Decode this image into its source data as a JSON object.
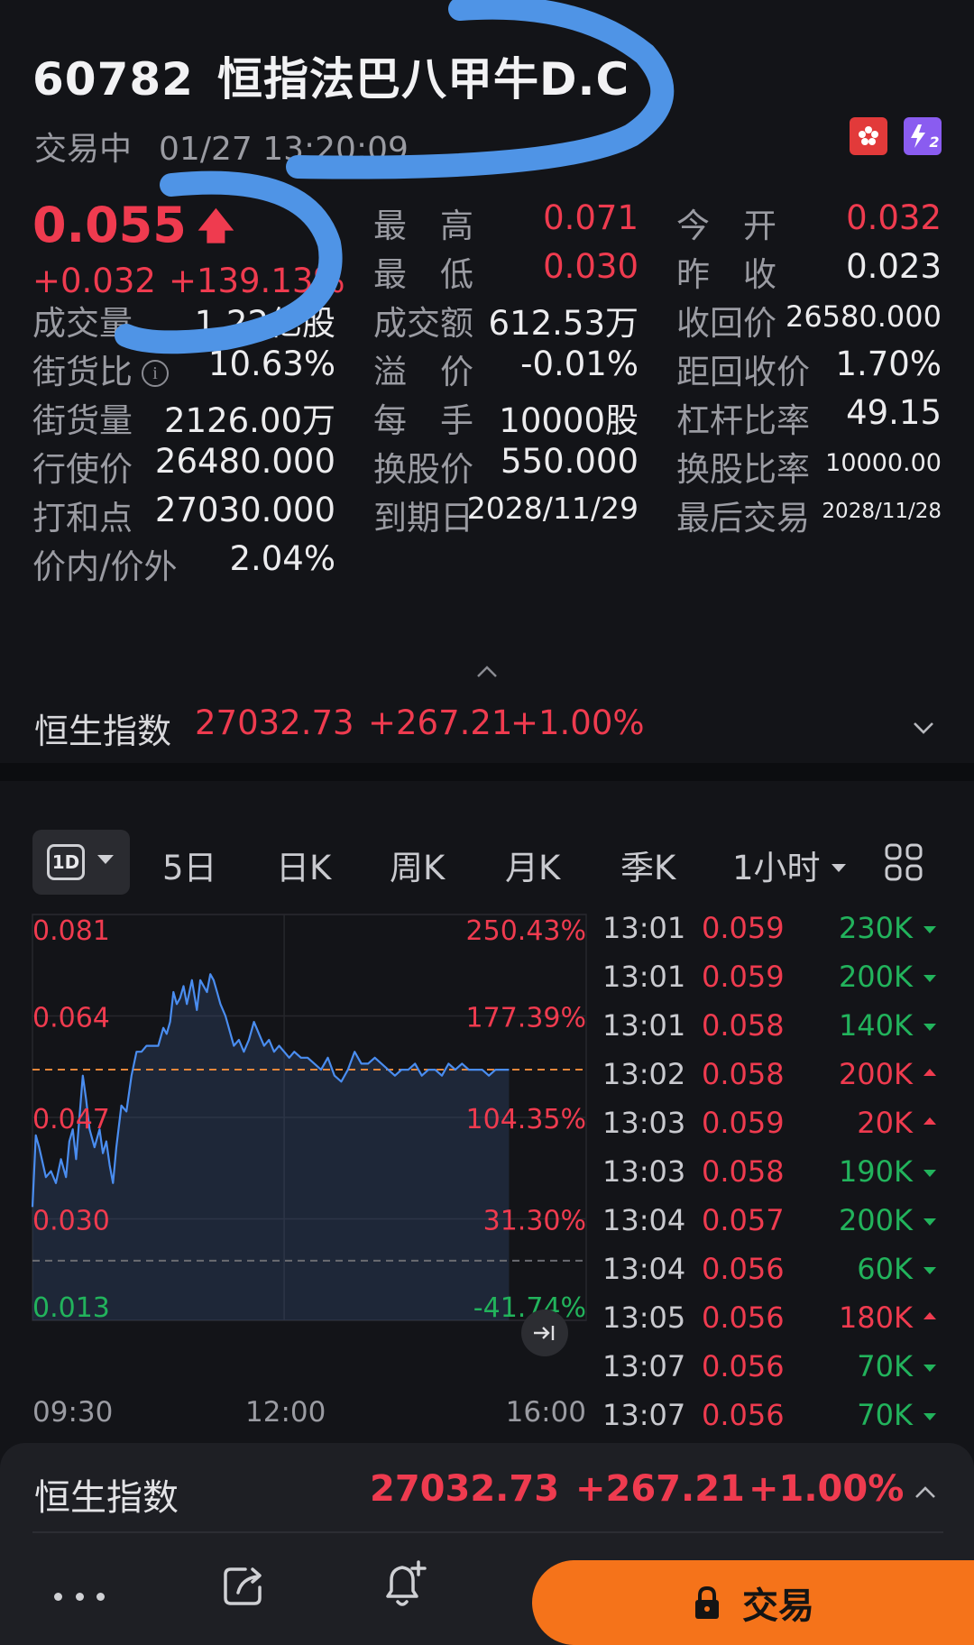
{
  "header": {
    "code": "60782",
    "name": "恒指法巴八甲牛D.C",
    "status": "交易中",
    "datetime": "01/27 13:20:09",
    "hk_flag_icon": "hong-kong-flag-icon",
    "lv2_badge_text": "2"
  },
  "quote": {
    "last_price": "0.055",
    "change": "+0.032",
    "change_pct": "+139.13%",
    "fields": {
      "volume": {
        "label": "成交量",
        "value": "1.22亿股"
      },
      "street_ratio": {
        "label": "街货比",
        "value": "10.63%"
      },
      "street_volume": {
        "label": "街货量",
        "value": "2126.00万"
      },
      "strike": {
        "label": "行使价",
        "value": "26480.000"
      },
      "breakeven": {
        "label": "打和点",
        "value": "27030.000"
      },
      "moneyness": {
        "label": "价内/价外",
        "value": "2.04%"
      },
      "high": {
        "label": "最　高",
        "value": "0.071"
      },
      "low": {
        "label": "最　低",
        "value": "0.030"
      },
      "turnover": {
        "label": "成交额",
        "value": "612.53万"
      },
      "premium": {
        "label": "溢　价",
        "value": "-0.01%"
      },
      "lot_size": {
        "label": "每　手",
        "value": "10000股"
      },
      "conversion_price": {
        "label": "换股价",
        "value": "550.000"
      },
      "expiry": {
        "label": "到期日",
        "value": "2028/11/29"
      },
      "open": {
        "label": "今　开",
        "value": "0.032"
      },
      "prev_close": {
        "label": "昨　收",
        "value": "0.023"
      },
      "call_price": {
        "label": "收回价",
        "value": "26580.000"
      },
      "call_distance": {
        "label": "距回收价",
        "value": "1.70%"
      },
      "leverage": {
        "label": "杠杆比率",
        "value": "49.15"
      },
      "conversion_ratio": {
        "label": "换股比率",
        "value": "10000.00"
      },
      "last_trade": {
        "label": "最后交易",
        "value": "2028/11/28"
      }
    }
  },
  "index_bar": {
    "label": "恒生指数",
    "value": "27032.73",
    "change": "+267.21",
    "change_pct": "+1.00%"
  },
  "tabs": {
    "intraday": "1D",
    "five_day": "5日",
    "daily": "日K",
    "weekly": "周K",
    "monthly": "月K",
    "quarterly": "季K",
    "hourly": "1小时"
  },
  "chart_data": {
    "type": "line",
    "title": "",
    "y_labels_left": [
      "0.081",
      "0.064",
      "0.047",
      "0.030",
      "0.013"
    ],
    "y_labels_right": [
      "250.43%",
      "177.39%",
      "104.35%",
      "31.30%",
      "-41.74%"
    ],
    "ylim": [
      0.013,
      0.081
    ],
    "x_labels": [
      "09:30",
      "12:00",
      "16:00"
    ],
    "x_range_minutes": [
      0,
      330
    ],
    "prev_close": 0.023,
    "reference_price": 0.055,
    "series": [
      {
        "x": [
          0,
          2,
          4,
          8,
          11,
          14,
          17,
          20,
          22,
          24,
          26,
          30,
          32,
          34,
          37,
          40,
          42,
          44,
          46,
          48,
          50,
          53,
          56,
          59,
          62,
          65,
          68,
          72,
          75,
          78,
          80,
          82,
          84,
          86,
          88,
          90,
          92,
          95,
          98,
          100,
          102,
          104,
          106,
          108,
          110,
          112,
          115,
          118,
          120,
          123,
          126,
          129,
          132,
          135,
          138,
          141,
          144,
          147,
          150,
          153,
          156,
          160,
          164,
          168,
          172,
          176,
          180,
          184,
          188,
          192,
          196,
          200,
          204,
          208,
          212,
          216,
          220,
          224,
          228,
          232,
          236,
          240,
          244,
          248,
          252,
          256,
          260,
          264,
          268,
          272,
          276,
          280,
          284
        ],
        "y": [
          0.032,
          0.044,
          0.042,
          0.037,
          0.038,
          0.036,
          0.04,
          0.037,
          0.043,
          0.045,
          0.04,
          0.054,
          0.05,
          0.045,
          0.042,
          0.045,
          0.041,
          0.043,
          0.039,
          0.036,
          0.042,
          0.049,
          0.048,
          0.054,
          0.058,
          0.058,
          0.059,
          0.059,
          0.059,
          0.062,
          0.061,
          0.063,
          0.068,
          0.066,
          0.067,
          0.069,
          0.066,
          0.07,
          0.065,
          0.07,
          0.069,
          0.068,
          0.071,
          0.07,
          0.068,
          0.066,
          0.064,
          0.061,
          0.059,
          0.06,
          0.058,
          0.06,
          0.063,
          0.061,
          0.059,
          0.06,
          0.058,
          0.059,
          0.058,
          0.057,
          0.058,
          0.057,
          0.057,
          0.056,
          0.055,
          0.057,
          0.054,
          0.053,
          0.055,
          0.058,
          0.056,
          0.056,
          0.057,
          0.056,
          0.055,
          0.054,
          0.055,
          0.055,
          0.056,
          0.054,
          0.055,
          0.055,
          0.054,
          0.056,
          0.055,
          0.056,
          0.055,
          0.055,
          0.055,
          0.054,
          0.055,
          0.055,
          0.055
        ]
      }
    ]
  },
  "ticks": [
    {
      "time": "13:01",
      "price": "0.059",
      "volume": "230K",
      "dir": "down"
    },
    {
      "time": "13:01",
      "price": "0.059",
      "volume": "200K",
      "dir": "down"
    },
    {
      "time": "13:01",
      "price": "0.058",
      "volume": "140K",
      "dir": "down"
    },
    {
      "time": "13:02",
      "price": "0.058",
      "volume": "200K",
      "dir": "up"
    },
    {
      "time": "13:03",
      "price": "0.059",
      "volume": "20K",
      "dir": "up"
    },
    {
      "time": "13:03",
      "price": "0.058",
      "volume": "190K",
      "dir": "down"
    },
    {
      "time": "13:04",
      "price": "0.057",
      "volume": "200K",
      "dir": "down"
    },
    {
      "time": "13:04",
      "price": "0.056",
      "volume": "60K",
      "dir": "down"
    },
    {
      "time": "13:05",
      "price": "0.056",
      "volume": "180K",
      "dir": "up"
    },
    {
      "time": "13:07",
      "price": "0.056",
      "volume": "70K",
      "dir": "down"
    },
    {
      "time": "13:07",
      "price": "0.056",
      "volume": "70K",
      "dir": "down"
    }
  ],
  "bottom": {
    "index_label": "恒生指数",
    "index_value": "27032.73",
    "index_change": "+267.21",
    "index_pct": "+1.00%",
    "trade_label": "交易"
  },
  "colors": {
    "up": "#ef3b4f",
    "down": "#22b35c",
    "line": "#4a8df0",
    "trade_button": "#f5731a",
    "scribble": "#4f94e6"
  }
}
